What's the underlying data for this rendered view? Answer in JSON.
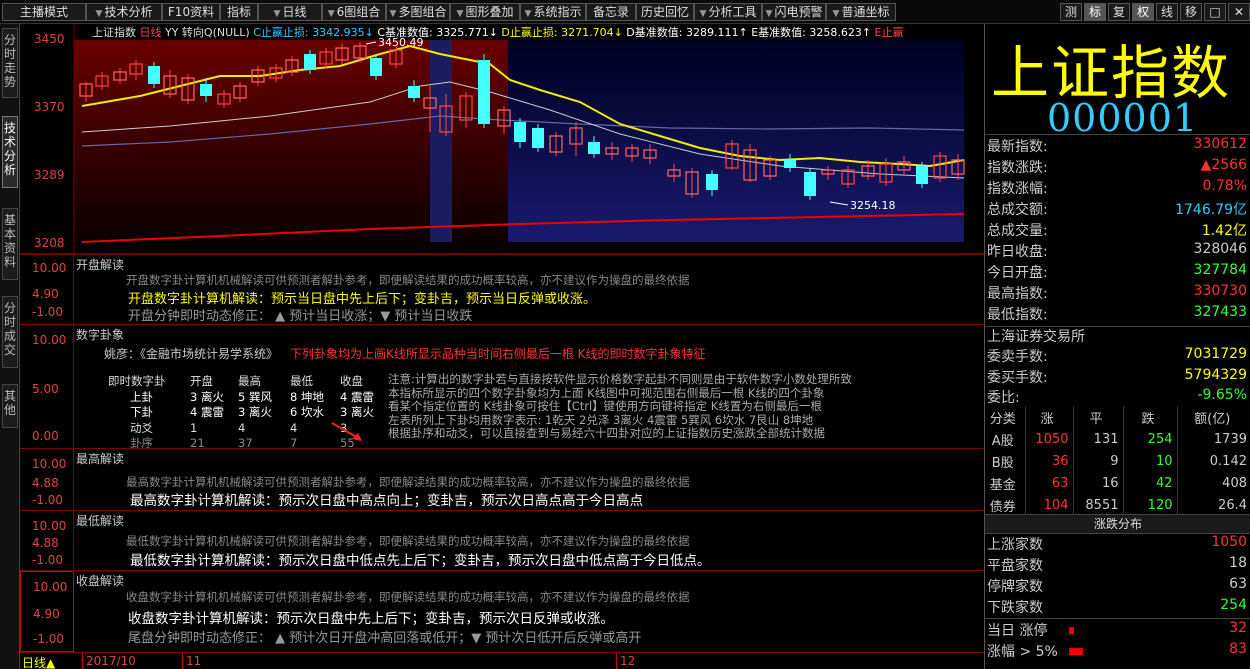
{
  "toolbar": {
    "items": [
      "主播模式",
      "技术分析",
      "F10资料",
      "指标",
      "日线",
      "6图组合",
      "多图组合",
      "图形叠加",
      "系统指示",
      "备忘录",
      "历史回忆",
      "分析工具",
      "闪电预警",
      "普通坐标"
    ],
    "right": [
      "测",
      "标",
      "复",
      "权",
      "线",
      "移",
      "□",
      "✕"
    ]
  },
  "sidetabs": [
    "分时走势",
    "技术分析",
    "基本资料",
    "分时成交",
    "其他"
  ],
  "chart": {
    "header": {
      "name": "上证指数",
      "period": "日线",
      "mode": "YY 转向Q(NULL)",
      "c_label": "C止赢止损:",
      "c_val": "3342.935↓",
      "c2_label": "C基准数值:",
      "c2_val": "3325.771↓",
      "d_label": "D止赢止损:",
      "d_val": "3271.704↓",
      "d2_label": "D基准数值:",
      "d2_val": "3289.111↑",
      "e_label": "E基准数值:",
      "e_val": "3258.623↑",
      "e2_label": "E止赢"
    },
    "y_labels": [
      "3450",
      "3370",
      "3289",
      "3208"
    ],
    "hi_label": "3450.49",
    "lo_label": "3254.18"
  },
  "panels": {
    "open": {
      "title": "开盘解读",
      "y": [
        "10.00",
        "4.90",
        "-1.00"
      ],
      "note": "开盘数字卦计算机机械解读可供预测者解卦参考，即便解读结果的成功概率较高，亦不建议作为操盘的最终依据",
      "main": "开盘数字卦计算机解读：预示当日盘中先上后下；变卦吉，预示当日反弹或收涨。",
      "sub": "开盘分钟即时动态修正：  ▲ 预计当日收涨；▼ 预计当日收跌"
    },
    "hexa": {
      "title": "数字卦象",
      "y": [
        "10.00",
        "5.00",
        "0.00"
      ],
      "author": "姚彦：《金融市场统计易学系统》",
      "red_note": "下列卦象均为上画K线所显示品种当时间右侧最后一根 K线的即时数字卦象特征",
      "head": [
        "即时数字卦",
        "开盘",
        "最高",
        "最低",
        "收盘"
      ],
      "rows": [
        [
          "上卦",
          "3 离火",
          "5 巽风",
          "8 坤地",
          "4 震雷"
        ],
        [
          "下卦",
          "4 震雷",
          "3 离火",
          "6 坎水",
          "3 离火"
        ],
        [
          "动爻",
          "1",
          "4",
          "4",
          "3"
        ],
        [
          "卦序",
          "21",
          "37",
          "7",
          "55"
        ]
      ],
      "notes": [
        "注意:计算出的数字卦若与直接按软件显示价格数字起卦不同则是由于软件数字小数处理所致",
        "     本指标所显示的四个数字卦象均为上面 K线图中可视范围右侧最后一根 K线的四个卦象",
        "     看某个指定位置的 K线卦象可按住【Ctrl】键使用方向键将指定 K线置为右侧最后一根",
        "     左表所列上下卦均用数字表示:  1乾天 2兑泽 3离火 4震雷 5巽风 6坎水 7艮山 8坤地",
        "     根据卦序和动爻，可以直接查到与易经六十四卦对应的上证指数历史涨跌全部统计数据"
      ]
    },
    "high": {
      "title": "最高解读",
      "y": [
        "10.00",
        "4.88",
        "-1.00"
      ],
      "note": "最高数字卦计算机机械解读可供预测者解卦参考，即便解读结果的成功概率较高，亦不建议作为操盘的最终依据",
      "main": "最高数字卦计算机解读：预示次日盘中高点向上；变卦吉，预示次日高点高于今日高点"
    },
    "low": {
      "title": "最低解读",
      "y": [
        "10.00",
        "4.88",
        "-1.00"
      ],
      "note": "最低数字卦计算机机械解读可供预测者解卦参考，即便解读结果的成功概率较高，亦不建议作为操盘的最终依据",
      "main": "最低数字卦计算机解读：预示次日盘中低点先上后下；变卦吉，预示次日盘中低点高于今日低点。"
    },
    "close": {
      "title": "收盘解读",
      "y": [
        "10.00",
        "4.90",
        "-1.00"
      ],
      "note": "收盘数字卦计算机机械解读可供预测者解卦参考，即便解读结果的成功概率较高，亦不建议作为操盘的最终依据",
      "main": "收盘数字卦计算机解读：预示次日盘中先上后下；变卦吉，预示次日反弹或收涨。",
      "sub": "尾盘分钟即时动态修正：  ▲ 预计次日开盘冲高回落或低开；▼ 预计次日低开后反弹或高开"
    }
  },
  "datebar": {
    "period": "日线▲",
    "d1": "2017/10",
    "d2": "11",
    "d3": "12"
  },
  "quote": {
    "title": "上证指数",
    "code": "000001",
    "rows": [
      {
        "k": "最新指数:",
        "v": "330612",
        "c": "#f33"
      },
      {
        "k": "指数涨跌:",
        "v": "▲2566",
        "c": "#f33"
      },
      {
        "k": "指数涨幅:",
        "v": "0.78%",
        "c": "#f33"
      },
      {
        "k": "总成交额:",
        "v": "1746.79亿",
        "c": "#3cf"
      },
      {
        "k": "总成交量:",
        "v": "1.42亿",
        "c": "#ff0"
      },
      {
        "k": "昨日收盘:",
        "v": "328046",
        "c": "#ccc"
      },
      {
        "k": "今日开盘:",
        "v": "327784",
        "c": "#3f3"
      },
      {
        "k": "最高指数:",
        "v": "330730",
        "c": "#f33"
      },
      {
        "k": "最低指数:",
        "v": "327433",
        "c": "#3f3"
      }
    ],
    "exchange": "上海证券交易所",
    "orders": [
      {
        "k": "委卖手数:",
        "v": "7031729",
        "c": "#ff0"
      },
      {
        "k": "委买手数:",
        "v": "5794329",
        "c": "#ff0"
      },
      {
        "k": "委比:",
        "v": "-9.65%",
        "c": "#3f3"
      }
    ],
    "mkt_head": [
      "分类",
      "涨",
      "平",
      "跌",
      "额(亿)"
    ],
    "mkt_rows": [
      [
        "A股",
        "1050",
        "131",
        "254",
        "1739"
      ],
      [
        "B股",
        "36",
        "9",
        "10",
        "0.142"
      ],
      [
        "基金",
        "63",
        "16",
        "42",
        "408"
      ],
      [
        "债券",
        "104",
        "8551",
        "120",
        "26.4"
      ]
    ],
    "dist_title": "涨跌分布",
    "dist": [
      {
        "k": "上涨家数",
        "v": "1050",
        "c": "#f33"
      },
      {
        "k": "平盘家数",
        "v": "18",
        "c": "#ccc"
      },
      {
        "k": "停牌家数",
        "v": "63",
        "c": "#ccc"
      },
      {
        "k": "下跌家数",
        "v": "254",
        "c": "#3f3"
      }
    ],
    "limit": [
      {
        "k": "当日 涨停",
        "v": "32",
        "c": "#f33"
      },
      {
        "k": "涨幅 > 5%",
        "v": "83",
        "c": "#f33"
      }
    ]
  }
}
